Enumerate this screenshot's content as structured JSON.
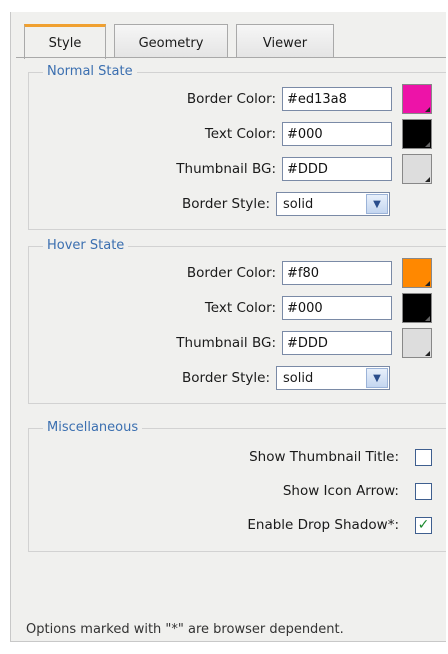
{
  "tabs": [
    "Style",
    "Geometry",
    "Viewer"
  ],
  "normal": {
    "title": "Normal State",
    "border_color_label": "Border Color:",
    "border_color": "#ed13a8",
    "text_color_label": "Text Color:",
    "text_color": "#000",
    "thumb_bg_label": "Thumbnail BG:",
    "thumb_bg": "#DDD",
    "border_style_label": "Border Style:",
    "border_style": "solid"
  },
  "hover": {
    "title": "Hover State",
    "border_color_label": "Border Color:",
    "border_color": "#f80",
    "text_color_label": "Text Color:",
    "text_color": "#000",
    "thumb_bg_label": "Thumbnail BG:",
    "thumb_bg": "#DDD",
    "border_style_label": "Border Style:",
    "border_style": "solid"
  },
  "misc": {
    "title": "Miscellaneous",
    "show_title_label": "Show Thumbnail Title:",
    "show_title": false,
    "show_arrow_label": "Show Icon Arrow:",
    "show_arrow": false,
    "drop_shadow_label": "Enable Drop Shadow*:",
    "drop_shadow": true
  },
  "colors": {
    "swatch_normal_border": "#ed13a8",
    "swatch_normal_text": "#000000",
    "swatch_normal_bg": "#dddddd",
    "swatch_hover_border": "#ff8800",
    "swatch_hover_text": "#000000",
    "swatch_hover_bg": "#dddddd",
    "tab_accent": "#f0a030",
    "section_title": "#3b6fb0"
  },
  "footer": "Options marked with \"*\" are browser dependent."
}
